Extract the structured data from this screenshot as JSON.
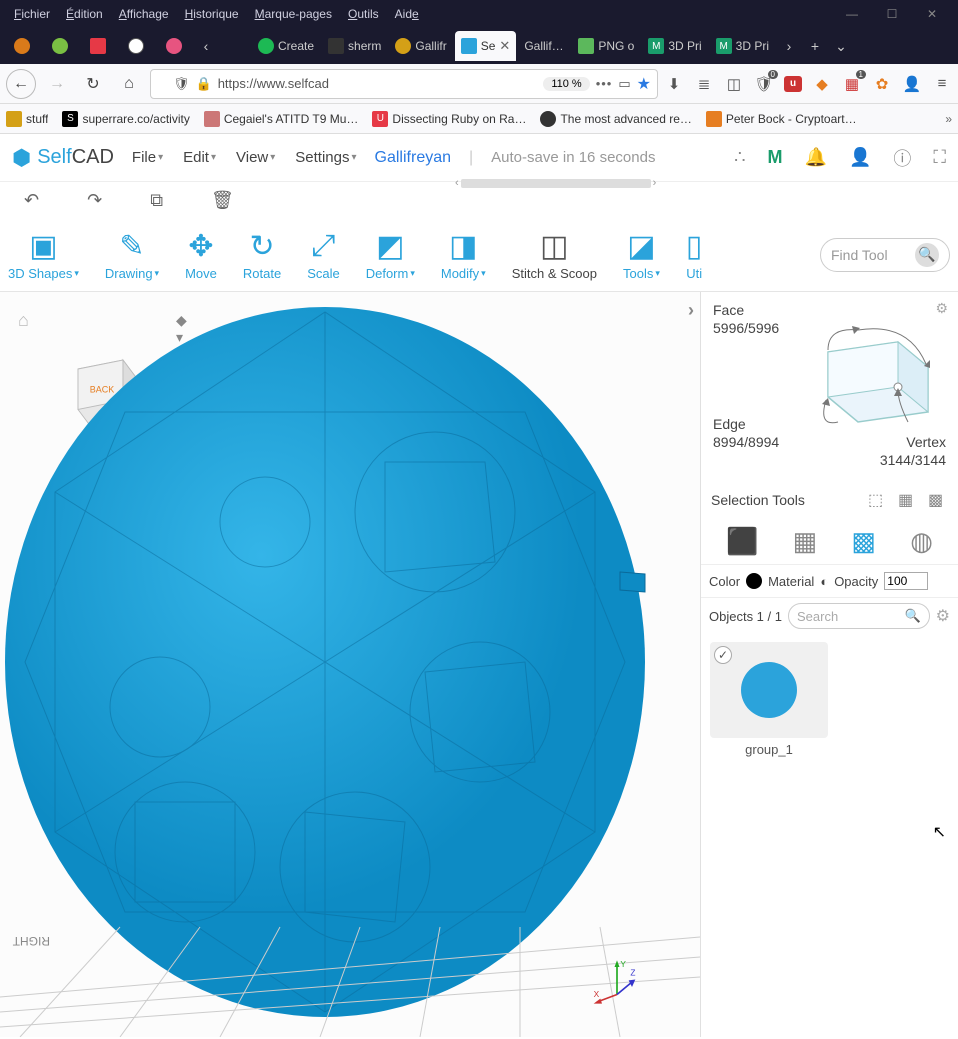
{
  "os_menu": [
    "Fichier",
    "Édition",
    "Affichage",
    "Historique",
    "Marque-pages",
    "Outils",
    "Aide"
  ],
  "tabs": {
    "pinned_colors": [
      "#d97a1a",
      "#7ac043",
      "#e63946",
      "#ffffff",
      "#e75480"
    ],
    "scroll_left": "‹",
    "items": [
      {
        "label": "Create",
        "color": "#1db954"
      },
      {
        "label": "sherm",
        "color": "#333"
      },
      {
        "label": "Gallifr",
        "color": "#d4a017"
      },
      {
        "label": "Se",
        "color": "#2ba3db",
        "active": true,
        "closable": true
      },
      {
        "label": "Gallifreyan",
        "color": "#999"
      },
      {
        "label": "PNG o",
        "color": "#5cb85c"
      },
      {
        "label": "3D Pri",
        "color": "#1a9c6b",
        "prefix": "M"
      },
      {
        "label": "3D Pri",
        "color": "#1a9c6b",
        "prefix": "M"
      }
    ],
    "scroll_right": "›",
    "new_tab": "+",
    "overflow": "⌄"
  },
  "urlbar": {
    "url": "https://www.selfcad",
    "zoom": "110 %"
  },
  "bookmarks": [
    {
      "label": "stuff",
      "color": "#d4a017"
    },
    {
      "label": "superrare.co/activity",
      "color": "#000"
    },
    {
      "label": "Cegaiel's ATITD T9 Mu…",
      "color": "#c77"
    },
    {
      "label": "Dissecting Ruby on Ra…",
      "color": "#e63946"
    },
    {
      "label": "The most advanced re…",
      "color": "#333"
    },
    {
      "label": "Peter Bock - Cryptoart…",
      "color": "#e67e22"
    }
  ],
  "app": {
    "brand_a": "Self",
    "brand_b": "CAD",
    "menus": [
      "File",
      "Edit",
      "View",
      "Settings"
    ],
    "project": "Gallifreyan",
    "autosave": "Auto-save in 16 seconds"
  },
  "ribbon": {
    "tools": [
      {
        "label": "3D Shapes",
        "caret": true,
        "glyph": "◧"
      },
      {
        "label": "Drawing",
        "caret": true,
        "glyph": "✎"
      },
      {
        "label": "Move",
        "caret": false,
        "glyph": "✥"
      },
      {
        "label": "Rotate",
        "caret": false,
        "glyph": "↻"
      },
      {
        "label": "Scale",
        "caret": false,
        "glyph": "⤢"
      },
      {
        "label": "Deform",
        "caret": true,
        "glyph": "◩"
      },
      {
        "label": "Modify",
        "caret": true,
        "glyph": "◨"
      },
      {
        "label": "Stitch & Scoop",
        "caret": false,
        "glyph": "◫",
        "dark": true
      },
      {
        "label": "Tools",
        "caret": true,
        "glyph": "◪"
      },
      {
        "label": "Uti",
        "caret": false,
        "glyph": "▯"
      }
    ],
    "find_placeholder": "Find Tool"
  },
  "mesh": {
    "face_label": "Face",
    "face_count": "5996/5996",
    "edge_label": "Edge",
    "edge_count": "8994/8994",
    "vertex_label": "Vertex",
    "vertex_count": "3144/3144"
  },
  "selection_tools_label": "Selection Tools",
  "color_row": {
    "color": "Color",
    "material": "Material",
    "opacity": "Opacity",
    "value": "100"
  },
  "objects": {
    "header": "Objects 1 / 1",
    "search_placeholder": "Search",
    "item_name": "group_1"
  },
  "nav_cube": {
    "back": "BACK"
  },
  "axes": {
    "x": "X",
    "y": "Y",
    "z": "Z"
  },
  "grid_label": "RIGHT"
}
